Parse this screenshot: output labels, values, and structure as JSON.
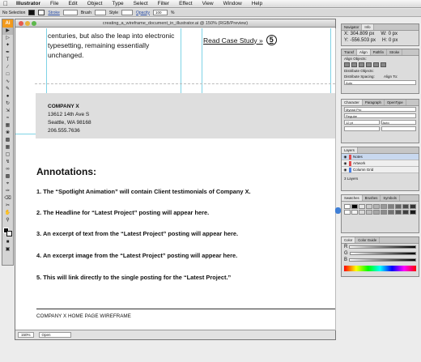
{
  "menubar": {
    "items": [
      "Illustrator",
      "File",
      "Edit",
      "Object",
      "Type",
      "Select",
      "Filter",
      "Effect",
      "View",
      "Window",
      "Help"
    ]
  },
  "controlbar": {
    "selection": "No Selection",
    "stroke_label": "Stroke",
    "brush_label": "Brush",
    "style_label": "Style",
    "opacity_label": "Opacity",
    "opacity_value": "100",
    "opacity_unit": "%"
  },
  "tools": {
    "header": "Ai"
  },
  "document": {
    "title": "creating_a_wireframe_document_in_illustrator.ai @ 150% (RGB/Preview)",
    "intro_text": "centuries, but also the leap into electronic typesetting, remaining essentially unchanged.",
    "read_more": "Read Case Study »",
    "read_more_badge": "5",
    "address": {
      "company": "COMPANY X",
      "street": "13612 14th Ave S",
      "city": "Seattle, WA 98168",
      "phone": "206.555.7636"
    },
    "annotations_title": "Annotations:",
    "annotations": [
      "1. The “Spotlight Animation” will contain Client testimonials of Company X.",
      "2. The Headline for “Latest Project” posting will appear here.",
      "3. An excerpt of text from the “Latest Project” posting will appear here.",
      "4. An excerpt image from the “Latest Project” posting will appear here.",
      "5. This will link directly to the single posting for the “Latest Project.”"
    ],
    "footer": "COMPANY X HOME PAGE WIREFRAME",
    "status": {
      "zoom": "150%",
      "mode": "Open"
    }
  },
  "panels": {
    "navigator": {
      "tabs": [
        "Navigator",
        "Info"
      ],
      "x": "304.809 px",
      "y": "-556.503 px",
      "w": "0 px",
      "h": "0 px"
    },
    "align": {
      "tabs": [
        "Transf",
        "Align",
        "Pathfin",
        "Stroke"
      ],
      "align_objects": "Align Objects:",
      "distribute_objects": "Distribute Objects:",
      "distribute_spacing": "Distribute Spacing:",
      "align_to": "Align To:",
      "spacing_value": "Auto"
    },
    "character": {
      "tabs": [
        "Character",
        "Paragraph",
        "OpenType"
      ],
      "font": "Myriad Pro",
      "style": "Regular",
      "size": "12 pt",
      "leading": "Auto"
    },
    "layers": {
      "tabs": [
        "Layers"
      ],
      "rows": [
        {
          "name": "Notes",
          "color": "#e34a4a",
          "selected": true
        },
        {
          "name": "Artwork",
          "color": "#e34a4a",
          "selected": false
        },
        {
          "name": "Column Grid",
          "color": "#4a7fe3",
          "selected": false
        }
      ],
      "count_label": "3 Layers"
    },
    "swatches": {
      "tabs": [
        "Swatches",
        "Brushes",
        "Symbols"
      ],
      "colors": [
        "#ffffff",
        "#000000",
        "#e6e6e6",
        "#cccccc",
        "#b3b3b3",
        "#999999",
        "#808080",
        "#666666",
        "#4d4d4d",
        "#333333",
        "#ffffff",
        "#f2f2f2",
        "#d9d9d9",
        "#bfbfbf",
        "#a6a6a6",
        "#8c8c8c",
        "#737373",
        "#595959",
        "#404040",
        "#1a1a1a"
      ]
    },
    "color": {
      "tabs": [
        "Color",
        "Color Guide"
      ],
      "labels": [
        "R",
        "G",
        "B"
      ]
    }
  }
}
